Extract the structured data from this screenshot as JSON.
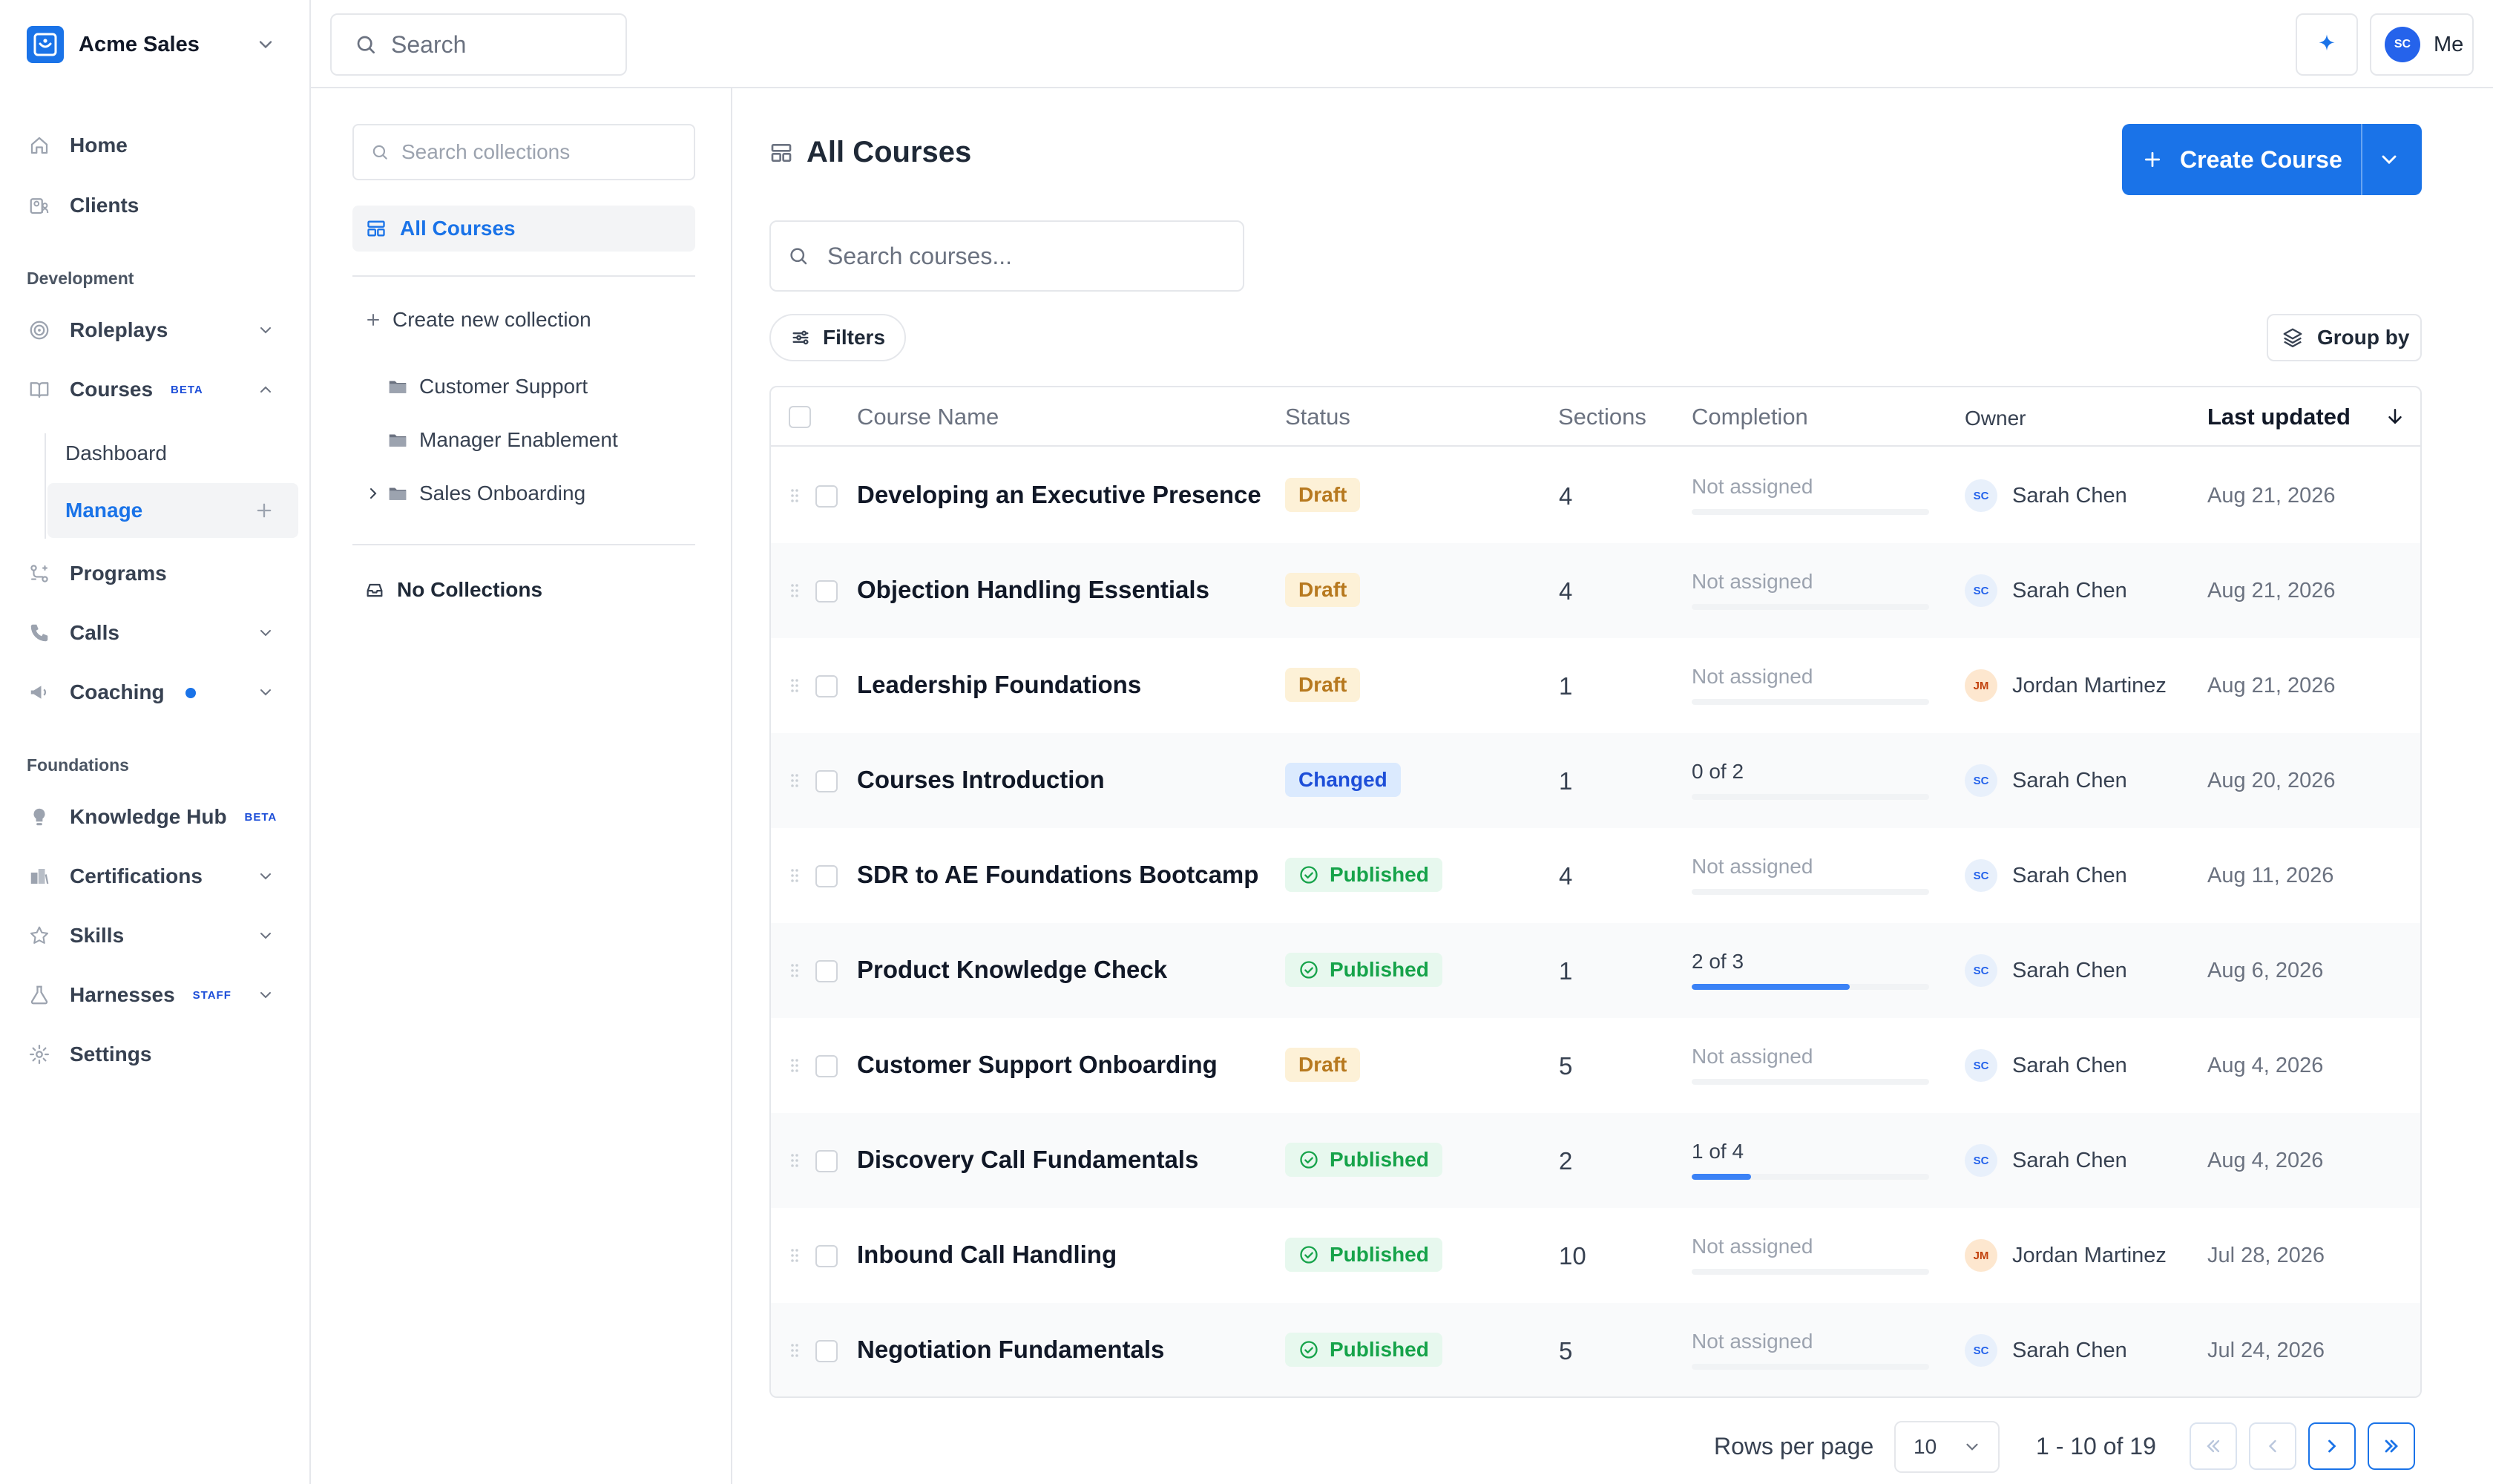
{
  "workspace": {
    "name": "Acme Sales"
  },
  "top_search": {
    "placeholder": "Search"
  },
  "user": {
    "initials": "SC",
    "label": "Me"
  },
  "nav": {
    "home": "Home",
    "clients": "Clients",
    "development_label": "Development",
    "roleplays": "Roleplays",
    "courses": "Courses",
    "courses_badge": "BETA",
    "dashboard": "Dashboard",
    "manage": "Manage",
    "programs": "Programs",
    "calls": "Calls",
    "coaching": "Coaching",
    "foundations_label": "Foundations",
    "knowledge_hub": "Knowledge Hub",
    "knowledge_badge": "BETA",
    "certifications": "Certifications",
    "skills": "Skills",
    "harnesses": "Harnesses",
    "harnesses_badge": "STAFF",
    "settings": "Settings"
  },
  "collections": {
    "search_placeholder": "Search collections",
    "all_courses": "All Courses",
    "create_new": "Create new collection",
    "items": [
      "Customer Support",
      "Manager Enablement",
      "Sales Onboarding"
    ],
    "no_collections": "No Collections"
  },
  "page": {
    "title": "All Courses",
    "create_button": "Create Course",
    "search_placeholder": "Search courses...",
    "filters": "Filters",
    "group_by": "Group by"
  },
  "table": {
    "headers": {
      "name": "Course Name",
      "status": "Status",
      "sections": "Sections",
      "completion": "Completion",
      "owner": "Owner",
      "updated": "Last updated"
    },
    "rows": [
      {
        "name": "Developing an Executive Presence",
        "status": "Draft",
        "sections": "4",
        "completion": "Not assigned",
        "progress": 0,
        "owner": "Sarah Chen",
        "owner_initials": "SC",
        "updated": "Aug 21, 2026"
      },
      {
        "name": "Objection Handling Essentials",
        "status": "Draft",
        "sections": "4",
        "completion": "Not assigned",
        "progress": 0,
        "owner": "Sarah Chen",
        "owner_initials": "SC",
        "updated": "Aug 21, 2026"
      },
      {
        "name": "Leadership Foundations",
        "status": "Draft",
        "sections": "1",
        "completion": "Not assigned",
        "progress": 0,
        "owner": "Jordan Martinez",
        "owner_initials": "JM",
        "updated": "Aug 21, 2026"
      },
      {
        "name": "Courses Introduction",
        "status": "Changed",
        "sections": "1",
        "completion": "0 of 2",
        "progress": 0,
        "owner": "Sarah Chen",
        "owner_initials": "SC",
        "updated": "Aug 20, 2026"
      },
      {
        "name": "SDR to AE Foundations Bootcamp",
        "status": "Published",
        "sections": "4",
        "completion": "Not assigned",
        "progress": 0,
        "owner": "Sarah Chen",
        "owner_initials": "SC",
        "updated": "Aug 11, 2026"
      },
      {
        "name": "Product Knowledge Check",
        "status": "Published",
        "sections": "1",
        "completion": "2 of 3",
        "progress": 0.667,
        "owner": "Sarah Chen",
        "owner_initials": "SC",
        "updated": "Aug 6, 2026"
      },
      {
        "name": "Customer Support Onboarding",
        "status": "Draft",
        "sections": "5",
        "completion": "Not assigned",
        "progress": 0,
        "owner": "Sarah Chen",
        "owner_initials": "SC",
        "updated": "Aug 4, 2026"
      },
      {
        "name": "Discovery Call Fundamentals",
        "status": "Published",
        "sections": "2",
        "completion": "1 of 4",
        "progress": 0.25,
        "owner": "Sarah Chen",
        "owner_initials": "SC",
        "updated": "Aug 4, 2026"
      },
      {
        "name": "Inbound Call Handling",
        "status": "Published",
        "sections": "10",
        "completion": "Not assigned",
        "progress": 0,
        "owner": "Jordan Martinez",
        "owner_initials": "JM",
        "updated": "Jul 28, 2026"
      },
      {
        "name": "Negotiation Fundamentals",
        "status": "Published",
        "sections": "5",
        "completion": "Not assigned",
        "progress": 0,
        "owner": "Sarah Chen",
        "owner_initials": "SC",
        "updated": "Jul 24, 2026"
      }
    ]
  },
  "pagination": {
    "rows_per_page_label": "Rows per page",
    "rows_per_page": "10",
    "range": "1 - 10 of 19"
  },
  "colors": {
    "accent": "#1a73e8",
    "draft": "#b7791f",
    "changed": "#1d4ed8",
    "published": "#16a34a"
  }
}
